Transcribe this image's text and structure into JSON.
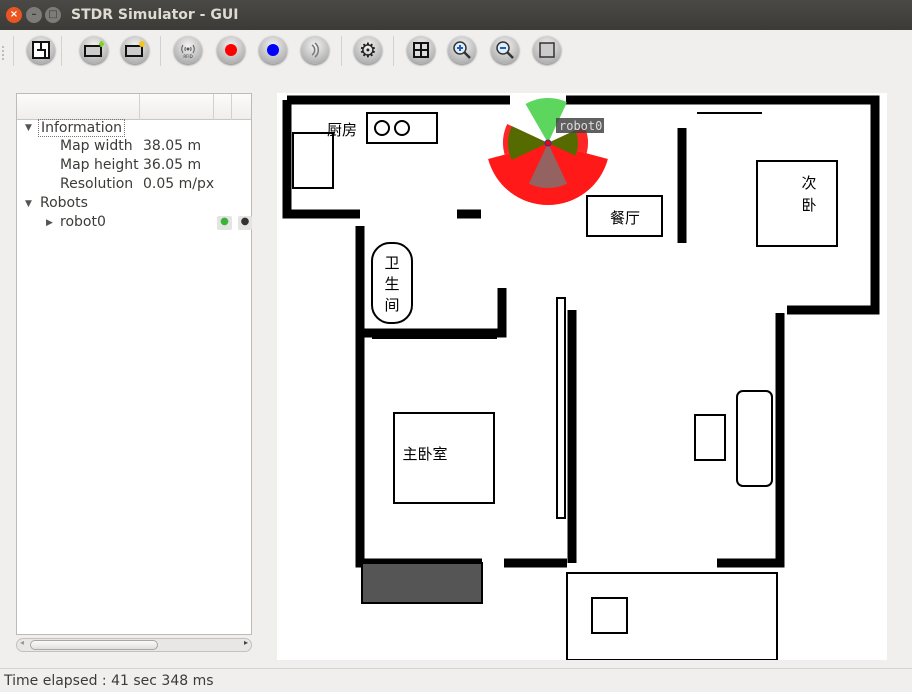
{
  "window": {
    "title": "STDR Simulator - GUI"
  },
  "toolbar": {
    "buttons": [
      {
        "name": "load-map",
        "icon": "map-icon"
      },
      {
        "name": "add-robot",
        "icon": "robot-add-icon"
      },
      {
        "name": "load-robot",
        "icon": "robot-load-icon"
      },
      {
        "name": "add-rfid",
        "icon": "rfid-icon",
        "label": "RFID"
      },
      {
        "name": "add-co2-source",
        "icon": "red-dot-icon",
        "color": "#ff0000"
      },
      {
        "name": "add-thermal-source",
        "icon": "blue-dot-icon",
        "color": "#0000ff"
      },
      {
        "name": "add-sound-source",
        "icon": "sound-icon"
      },
      {
        "name": "properties",
        "icon": "gear-icon"
      },
      {
        "name": "grid",
        "icon": "grid-icon"
      },
      {
        "name": "zoom-in",
        "icon": "zoom-in-icon"
      },
      {
        "name": "zoom-out",
        "icon": "zoom-out-icon"
      },
      {
        "name": "adjust",
        "icon": "square-icon"
      }
    ]
  },
  "tree": {
    "information": {
      "label": "Information",
      "items": [
        {
          "key": "Map width",
          "value": "38.05 m"
        },
        {
          "key": "Map height",
          "value": "36.05 m"
        },
        {
          "key": "Resolution",
          "value": "0.05 m/px"
        }
      ]
    },
    "robots": {
      "label": "Robots",
      "items": [
        {
          "label": "robot0",
          "visibility_icon": "eye-icon",
          "visibility_color": "#3bb33b"
        }
      ]
    }
  },
  "map": {
    "robot_label": "robot0",
    "room_labels": [
      "厨房",
      "餐厅",
      "次",
      "卧",
      "卫",
      "生",
      "间",
      "主卧室"
    ],
    "sensor_colors": {
      "laser": "#ff0000",
      "sonar_front": "#33cc33",
      "sonar_side": "#556b00",
      "sonar_back": "#8a6a6a"
    }
  },
  "status": {
    "text": "Time elapsed : 41 sec 348 ms"
  }
}
